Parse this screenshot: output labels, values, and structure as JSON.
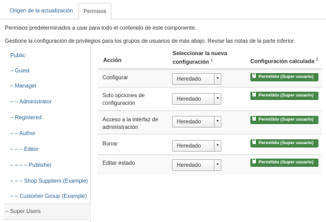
{
  "tabs": [
    {
      "label": "Origen de la actualización"
    },
    {
      "label": "Permisos"
    }
  ],
  "intro": {
    "line1": "Permisos predeterminados a usar para todo el contenido de este componente.",
    "line2": "Gestione la configuración de privilegios para los grupos de usuarios de más abajo. Revise las notas de la parte inferior."
  },
  "sidebar": {
    "items": [
      {
        "label": "Public"
      },
      {
        "label": "– Guest"
      },
      {
        "label": "– Manager"
      },
      {
        "label": "– – Administrator"
      },
      {
        "label": "– Registered"
      },
      {
        "label": "– – Author"
      },
      {
        "label": "– – – Editor"
      },
      {
        "label": "– – – – Publisher"
      },
      {
        "label": "– – – Shop Suppliers (Example)"
      },
      {
        "label": "– – Customer Group (Example)"
      },
      {
        "label": "– Super Users"
      }
    ]
  },
  "table": {
    "headers": {
      "action": "Acción",
      "select_line1": "Seleccionar la nueva",
      "select_line2": "configuración",
      "select_note": "1",
      "calc": "Configuración calculada",
      "calc_note": "2"
    },
    "rows": [
      {
        "action_l1": "Configurar",
        "action_l2": "",
        "select": "Heredado",
        "badge": "Permitido (Super usuario)"
      },
      {
        "action_l1": "Solo opciones de",
        "action_l2": "configuración",
        "select": "Heredado",
        "badge": "Permitido (Super usuario)"
      },
      {
        "action_l1": "Acceso a la interfaz de",
        "action_l2": "administración",
        "select": "Heredado",
        "badge": "Permitido (Super usuario)"
      },
      {
        "action_l1": "Borrar",
        "action_l2": "",
        "select": "Heredado",
        "badge": "Permitido (Super usuario)"
      },
      {
        "action_l1": "Editar estado",
        "action_l2": "",
        "select": "Heredado",
        "badge": "Permitido (Super usuario)"
      }
    ]
  },
  "colors": {
    "link": "#2a6496",
    "badge_success": "#468847"
  },
  "icons": {
    "badge_icon": "lock-icon",
    "select_icon": "dropdown-arrow-icon"
  }
}
